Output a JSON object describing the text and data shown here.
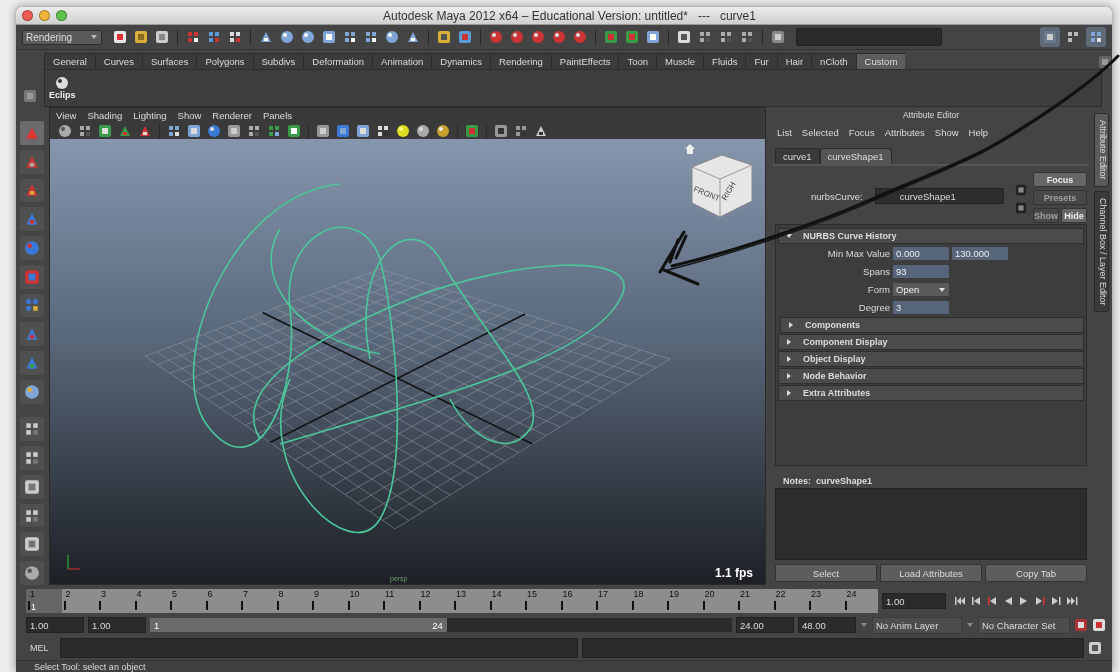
{
  "window": {
    "title": "Autodesk Maya 2012 x64 – Educational Version: untitled*   ---   curve1"
  },
  "status_line": {
    "menu_set": "Rendering"
  },
  "shelf": {
    "tabs": [
      {
        "label": "General",
        "selected": false
      },
      {
        "label": "Curves",
        "selected": false
      },
      {
        "label": "Surfaces",
        "selected": false
      },
      {
        "label": "Polygons",
        "selected": false
      },
      {
        "label": "Subdivs",
        "selected": false
      },
      {
        "label": "Deformation",
        "selected": false
      },
      {
        "label": "Animation",
        "selected": false
      },
      {
        "label": "Dynamics",
        "selected": false
      },
      {
        "label": "Rendering",
        "selected": false
      },
      {
        "label": "PaintEffects",
        "selected": false
      },
      {
        "label": "Toon",
        "selected": false
      },
      {
        "label": "Muscle",
        "selected": false
      },
      {
        "label": "Fluids",
        "selected": false
      },
      {
        "label": "Fur",
        "selected": false
      },
      {
        "label": "Hair",
        "selected": false
      },
      {
        "label": "nCloth",
        "selected": false
      },
      {
        "label": "Custom",
        "selected": true
      }
    ],
    "items": [
      {
        "label": "Eclips"
      }
    ]
  },
  "viewport": {
    "menus": [
      "View",
      "Shading",
      "Lighting",
      "Show",
      "Renderer",
      "Panels"
    ],
    "view_cube": {
      "front": "FRONT",
      "side": "RIGH"
    },
    "camera": "persp",
    "fps": "1.1 fps"
  },
  "attribute_editor": {
    "title": "Attribute Editor",
    "menus": [
      "List",
      "Selected",
      "Focus",
      "Attributes",
      "Show",
      "Help"
    ],
    "tabs": [
      {
        "label": "curve1",
        "selected": false
      },
      {
        "label": "curveShape1",
        "selected": true
      }
    ],
    "node": {
      "label": "nurbsCurve:",
      "value": "curveShape1"
    },
    "buttons": [
      {
        "label": "Focus",
        "disabled": false
      },
      {
        "label": "Presets",
        "disabled": true
      }
    ],
    "toggle_buttons": [
      {
        "label": "Show",
        "disabled": true
      },
      {
        "label": "Hide",
        "disabled": false
      }
    ],
    "sections": [
      {
        "title": "NURBS Curve History",
        "expanded": true,
        "fields": [
          {
            "label": "Min Max Value",
            "kind": "pair",
            "values": [
              "0.000",
              "130.000"
            ]
          },
          {
            "label": "Spans",
            "kind": "number",
            "values": [
              "93"
            ]
          },
          {
            "label": "Form",
            "kind": "dropdown",
            "values": [
              "Open"
            ]
          },
          {
            "label": "Degree",
            "kind": "number",
            "values": [
              "3"
            ]
          }
        ],
        "subsections": [
          {
            "title": "Components",
            "expanded": false
          }
        ]
      },
      {
        "title": "Component Display",
        "expanded": false
      },
      {
        "title": "Object Display",
        "expanded": false
      },
      {
        "title": "Node Behavior",
        "expanded": false
      },
      {
        "title": "Extra Attributes",
        "expanded": false
      }
    ],
    "notes": {
      "label": "Notes:",
      "node": "curveShape1"
    },
    "bottom_buttons": [
      "Select",
      "Load Attributes",
      "Copy Tab"
    ]
  },
  "side_tabs": [
    {
      "label": "Attribute Editor",
      "selected": true
    },
    {
      "label": "Channel Box / Layer Editor",
      "selected": false
    }
  ],
  "time_slider": {
    "frames": [
      {
        "label": "1",
        "selected": true
      },
      {
        "label": "2",
        "selected": false
      },
      {
        "label": "3",
        "selected": false
      },
      {
        "label": "4",
        "selected": false
      },
      {
        "label": "5",
        "selected": false
      },
      {
        "label": "6",
        "selected": false
      },
      {
        "label": "7",
        "selected": false
      },
      {
        "label": "8",
        "selected": false
      },
      {
        "label": "9",
        "selected": false
      },
      {
        "label": "10",
        "selected": false
      },
      {
        "label": "11",
        "selected": false
      },
      {
        "label": "12",
        "selected": false
      },
      {
        "label": "13",
        "selected": false
      },
      {
        "label": "14",
        "selected": false
      },
      {
        "label": "15",
        "selected": false
      },
      {
        "label": "16",
        "selected": false
      },
      {
        "label": "17",
        "selected": false
      },
      {
        "label": "18",
        "selected": false
      },
      {
        "label": "19",
        "selected": false
      },
      {
        "label": "20",
        "selected": false
      },
      {
        "label": "21",
        "selected": false
      },
      {
        "label": "22",
        "selected": false
      },
      {
        "label": "23",
        "selected": false
      },
      {
        "label": "24",
        "selected": false
      }
    ],
    "current_frame": "1",
    "current_time": "1.00"
  },
  "range_slider": {
    "start": "1.00",
    "playback_start": "1.00",
    "slider_start": "1",
    "slider_end": "24",
    "level": 0.51,
    "playback_end": "24.00",
    "end": "48.00",
    "anim_layer": "No Anim Layer",
    "character_set": "No Character Set"
  },
  "command_line": {
    "label": "MEL"
  },
  "help_line": {
    "text": "Select Tool: select an object"
  }
}
